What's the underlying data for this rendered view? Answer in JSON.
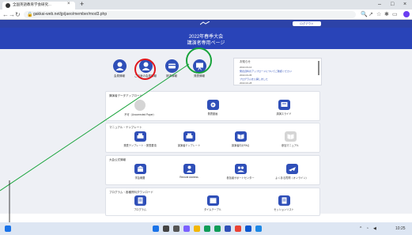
{
  "browser": {
    "tab_title": "全国英語教育学会研究...",
    "tab_close": "×",
    "new_tab": "+",
    "url": "gakkai-web.net/jp/jaeo/member/mod3.php",
    "window_controls": [
      "–",
      "□",
      "×"
    ]
  },
  "header": {
    "user_button": "ログアウト",
    "title_line1": "2022年春季大会",
    "title_line2": "講演者専用ページ"
  },
  "top_icons": [
    {
      "label": "会員情報",
      "icon": "person-icon"
    },
    {
      "label": "ご自身の会員情報",
      "icon": "person-icon"
    },
    {
      "label": "請求情報",
      "icon": "card-icon"
    },
    {
      "label": "発表情報",
      "icon": "presentation-icon"
    }
  ],
  "notices": {
    "title": "お知らせ",
    "lines": [
      "2022-03-10",
      "発表資料のアップロードについてご確認ください",
      "2022-03-05",
      "プログラムを公開しました",
      "2022-02-28"
    ]
  },
  "sections": [
    {
      "title": "講演者データアップロード",
      "items": [
        {
          "label": "不可（Uncorrected Paper）",
          "icon": "upload-disabled-icon",
          "color": "#d5d5d5"
        },
        {
          "label": "発表動画",
          "icon": "video-icon",
          "color": "#2f4fb8"
        },
        {
          "label": "講演スライド",
          "icon": "slides-icon",
          "color": "#2f4fb8"
        }
      ]
    },
    {
      "title": "マニュアル・テンプレート",
      "items": [
        {
          "label": "発表テンプレート・発表要項",
          "icon": "printer-icon",
          "color": "#2f4fb8"
        },
        {
          "label": "講演者テンプレート",
          "icon": "printer-icon",
          "color": "#2f4fb8"
        },
        {
          "label": "講演者向けFAQ",
          "icon": "book-icon",
          "color": "#2f4fb8"
        },
        {
          "label": "参加マニュアル",
          "icon": "book-icon",
          "color": "#d5d5d5"
        }
      ]
    },
    {
      "title": "大会公式情報",
      "items": [
        {
          "label": "学会概要",
          "icon": "building-icon",
          "color": "#2f4fb8"
        },
        {
          "label": "Remote Address",
          "icon": "person-icon",
          "color": "#2f4fb8"
        },
        {
          "label": "参加者サポートセンター",
          "icon": "support-icon",
          "color": "#2f4fb8"
        },
        {
          "label": "よくある質問（オンライン）",
          "icon": "plane-icon",
          "color": "#2f4fb8"
        }
      ]
    },
    {
      "title": "プログラム・各種資料ダウンロード",
      "items": [
        {
          "label": "プログラム",
          "icon": "document-icon",
          "color": "#2f4fb8"
        },
        {
          "label": "タイムテーブル",
          "icon": "calendar-icon",
          "color": "#2f4fb8"
        },
        {
          "label": "セッションリスト",
          "icon": "document-icon",
          "color": "#2f4fb8"
        }
      ]
    }
  ],
  "taskbar": {
    "clock": "10:25",
    "date": "2022/03"
  },
  "colors": {
    "header_dark": "#2d43a8",
    "header": "#2944b8",
    "annotation_red": "#e0161c",
    "annotation_green": "#17a33a"
  }
}
